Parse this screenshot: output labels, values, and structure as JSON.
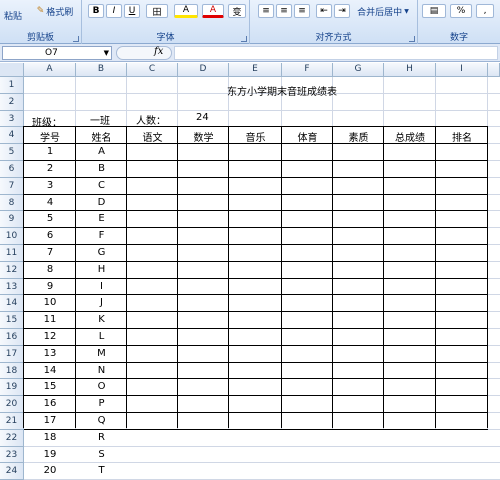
{
  "ribbon": {
    "clipboard": {
      "paste": "粘贴",
      "format_painter": "格式刷",
      "group_label": "剪贴板"
    },
    "font": {
      "bold": "B",
      "italic": "I",
      "underline": "U",
      "border": "田",
      "fill": "A",
      "font_color": "A",
      "phonetic": "变",
      "group_label": "字体"
    },
    "alignment": {
      "merge_center": "合并后居中",
      "group_label": "对齐方式"
    },
    "number": {
      "percent": "%",
      "comma": ",",
      "group_label": "数字"
    }
  },
  "formula_bar": {
    "name_box": "O7",
    "fx": "fx",
    "formula": ""
  },
  "columns": [
    "A",
    "B",
    "C",
    "D",
    "E",
    "F",
    "G",
    "H",
    "I"
  ],
  "rows": [
    "1",
    "2",
    "3",
    "4",
    "5",
    "6",
    "7",
    "8",
    "9",
    "10",
    "11",
    "12",
    "13",
    "14",
    "15",
    "16",
    "17",
    "18",
    "19",
    "20",
    "21",
    "22",
    "23",
    "24"
  ],
  "sheet": {
    "title": "东方小学期末音班成绩表",
    "class_label": "班级：",
    "class_value": "一班",
    "count_label": "人数：",
    "count_value": "24",
    "headers": [
      "学号",
      "姓名",
      "语文",
      "数学",
      "音乐",
      "体育",
      "素质",
      "总成绩",
      "排名"
    ],
    "students": [
      {
        "id": "1",
        "name": "A"
      },
      {
        "id": "2",
        "name": "B"
      },
      {
        "id": "3",
        "name": "C"
      },
      {
        "id": "4",
        "name": "D"
      },
      {
        "id": "5",
        "name": "E"
      },
      {
        "id": "6",
        "name": "F"
      },
      {
        "id": "7",
        "name": "G"
      },
      {
        "id": "8",
        "name": "H"
      },
      {
        "id": "9",
        "name": "I"
      },
      {
        "id": "10",
        "name": "J"
      },
      {
        "id": "11",
        "name": "K"
      },
      {
        "id": "12",
        "name": "L"
      },
      {
        "id": "13",
        "name": "M"
      },
      {
        "id": "14",
        "name": "N"
      },
      {
        "id": "15",
        "name": "O"
      },
      {
        "id": "16",
        "name": "P"
      },
      {
        "id": "17",
        "name": "Q"
      },
      {
        "id": "18",
        "name": "R"
      },
      {
        "id": "19",
        "name": "S"
      },
      {
        "id": "20",
        "name": "T"
      }
    ]
  }
}
